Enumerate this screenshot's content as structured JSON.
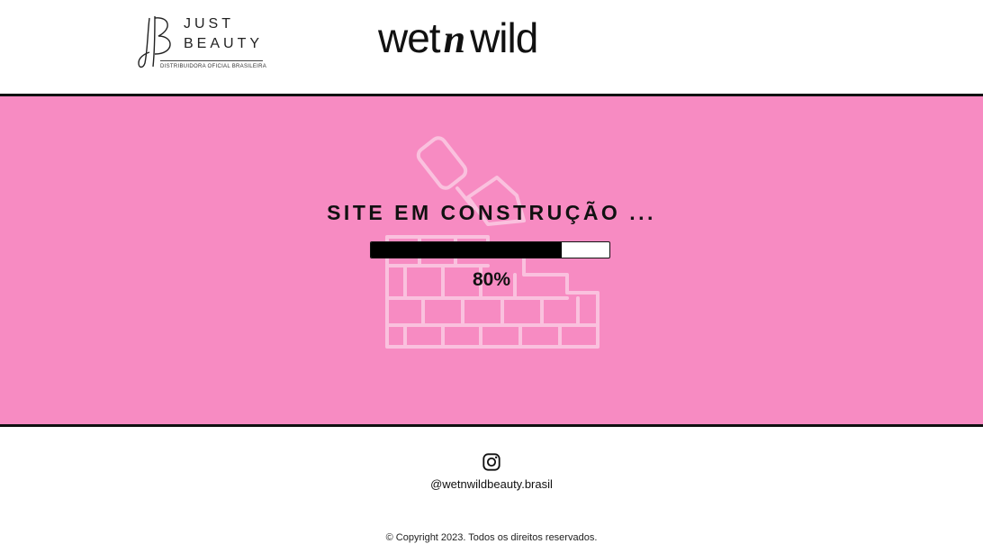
{
  "header": {
    "distributor_logo": {
      "line1": "JUST",
      "line2": "BEAUTY",
      "tagline": "DISTRIBUIDORA OFICIAL BRASILEIRA",
      "icon": "jb-monogram-icon"
    },
    "brand_logo": {
      "part1": "wet",
      "part2": "n",
      "part3": "wild"
    }
  },
  "main": {
    "background_color": "#f78bc2",
    "illustration_icon": "construction-wall-trowel-icon",
    "title": "SITE EM CONSTRUÇÃO ...",
    "progress": {
      "value": 0.8,
      "label": "80%"
    }
  },
  "footer": {
    "instagram_icon": "instagram-icon",
    "instagram_handle": "@wetnwildbeauty.brasil",
    "copyright": "© Copyright 2023. Todos os direitos reservados."
  }
}
